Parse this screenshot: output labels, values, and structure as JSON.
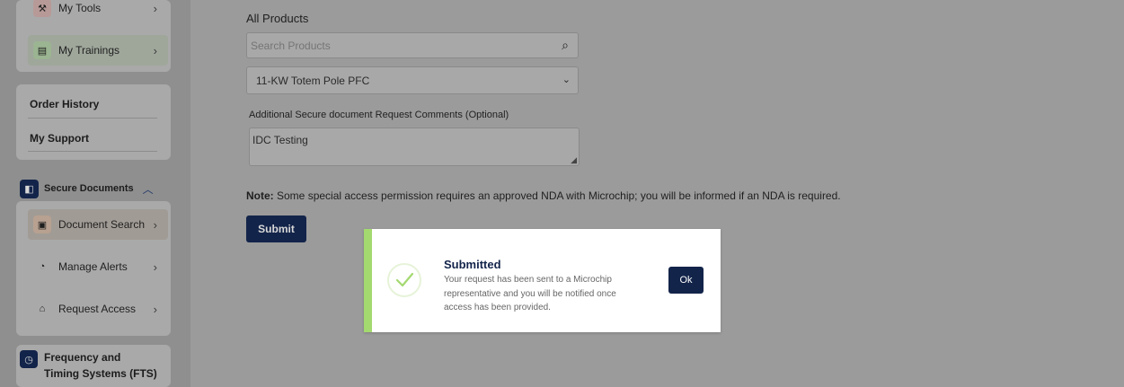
{
  "sidebar": {
    "top_items": [
      {
        "label": "My Tools",
        "icon": "tools-icon"
      },
      {
        "label": "My Trainings",
        "icon": "trainings-icon"
      }
    ],
    "links": [
      "Order History",
      "My Support"
    ],
    "secure_documents": {
      "label": "Secure Documents",
      "items": [
        {
          "label": "Document Search",
          "icon": "document-icon"
        },
        {
          "label": "Manage Alerts",
          "icon": "alert-icon"
        },
        {
          "label": "Request Access",
          "icon": "lock-icon"
        }
      ]
    },
    "fts": {
      "label_line1": "Frequency and",
      "label_line2": "Timing Systems (FTS)"
    }
  },
  "form": {
    "products_label": "All Products",
    "search_placeholder": "Search Products",
    "selected_product": "11-KW Totem Pole PFC",
    "comments_label": "Additional Secure document Request Comments (Optional)",
    "comments_value": "IDC Testing",
    "note_prefix": "Note:",
    "note_text": " Some special access permission requires an approved NDA with Microchip; you will be informed if an NDA is required.",
    "submit_label": "Submit"
  },
  "dialog": {
    "title": "Submitted",
    "line1": "Your request has been sent to a Microchip",
    "line2": "representative and you will be notified once",
    "line3": "access has been provided.",
    "ok_label": "Ok"
  },
  "colors": {
    "navy": "#13244a",
    "success_green": "#a4d96f",
    "overlay_gray": "#9b9b9b"
  }
}
